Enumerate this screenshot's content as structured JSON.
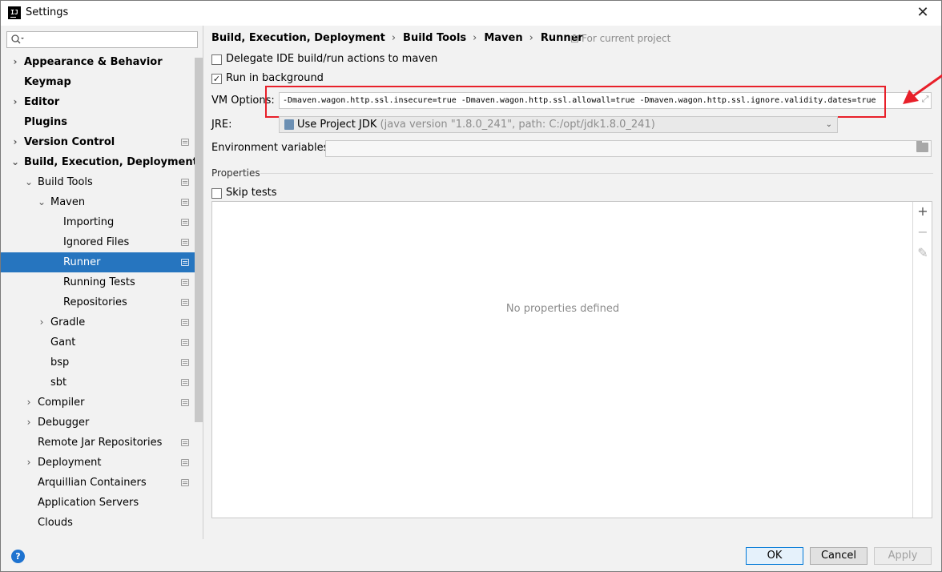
{
  "window": {
    "title": "Settings",
    "app_icon_text": "IJ",
    "close_glyph": "✕"
  },
  "sidebar": {
    "search_placeholder": "",
    "items": [
      {
        "label": "Appearance & Behavior",
        "bold": true,
        "expandable": true,
        "expanded": false,
        "level": 0,
        "config_icon": false,
        "selected": false
      },
      {
        "label": "Keymap",
        "bold": true,
        "expandable": false,
        "level": 0,
        "config_icon": false,
        "selected": false
      },
      {
        "label": "Editor",
        "bold": true,
        "expandable": true,
        "expanded": false,
        "level": 0,
        "config_icon": false,
        "selected": false
      },
      {
        "label": "Plugins",
        "bold": true,
        "expandable": false,
        "level": 0,
        "config_icon": false,
        "selected": false
      },
      {
        "label": "Version Control",
        "bold": true,
        "expandable": true,
        "expanded": false,
        "level": 0,
        "config_icon": true,
        "selected": false
      },
      {
        "label": "Build, Execution, Deployment",
        "bold": true,
        "expandable": true,
        "expanded": true,
        "level": 0,
        "config_icon": false,
        "selected": false
      },
      {
        "label": "Build Tools",
        "bold": false,
        "expandable": true,
        "expanded": true,
        "level": 1,
        "config_icon": true,
        "selected": false
      },
      {
        "label": "Maven",
        "bold": false,
        "expandable": true,
        "expanded": true,
        "level": 2,
        "config_icon": true,
        "selected": false
      },
      {
        "label": "Importing",
        "bold": false,
        "expandable": false,
        "level": 3,
        "config_icon": true,
        "selected": false
      },
      {
        "label": "Ignored Files",
        "bold": false,
        "expandable": false,
        "level": 3,
        "config_icon": true,
        "selected": false
      },
      {
        "label": "Runner",
        "bold": false,
        "expandable": false,
        "level": 3,
        "config_icon": true,
        "selected": true
      },
      {
        "label": "Running Tests",
        "bold": false,
        "expandable": false,
        "level": 3,
        "config_icon": true,
        "selected": false
      },
      {
        "label": "Repositories",
        "bold": false,
        "expandable": false,
        "level": 3,
        "config_icon": true,
        "selected": false
      },
      {
        "label": "Gradle",
        "bold": false,
        "expandable": true,
        "expanded": false,
        "level": 2,
        "config_icon": true,
        "selected": false
      },
      {
        "label": "Gant",
        "bold": false,
        "expandable": false,
        "level": 2,
        "config_icon": true,
        "selected": false
      },
      {
        "label": "bsp",
        "bold": false,
        "expandable": false,
        "level": 2,
        "config_icon": true,
        "selected": false
      },
      {
        "label": "sbt",
        "bold": false,
        "expandable": false,
        "level": 2,
        "config_icon": true,
        "selected": false
      },
      {
        "label": "Compiler",
        "bold": false,
        "expandable": true,
        "expanded": false,
        "level": 1,
        "config_icon": true,
        "selected": false
      },
      {
        "label": "Debugger",
        "bold": false,
        "expandable": true,
        "expanded": false,
        "level": 1,
        "config_icon": false,
        "selected": false
      },
      {
        "label": "Remote Jar Repositories",
        "bold": false,
        "expandable": false,
        "level": 1,
        "config_icon": true,
        "selected": false
      },
      {
        "label": "Deployment",
        "bold": false,
        "expandable": true,
        "expanded": false,
        "level": 1,
        "config_icon": true,
        "selected": false
      },
      {
        "label": "Arquillian Containers",
        "bold": false,
        "expandable": false,
        "level": 1,
        "config_icon": true,
        "selected": false
      },
      {
        "label": "Application Servers",
        "bold": false,
        "expandable": false,
        "level": 1,
        "config_icon": false,
        "selected": false
      },
      {
        "label": "Clouds",
        "bold": false,
        "expandable": false,
        "level": 1,
        "config_icon": false,
        "selected": false
      }
    ]
  },
  "breadcrumb": {
    "parts": [
      "Build, Execution, Deployment",
      "Build Tools",
      "Maven",
      "Runner"
    ],
    "separator": "›",
    "scope_label": "For current project"
  },
  "options": {
    "delegate": {
      "label": "Delegate IDE build/run actions to maven",
      "checked": false
    },
    "run_background": {
      "label": "Run in background",
      "checked": true
    },
    "vm_options": {
      "label": "VM Options:",
      "value": "-Dmaven.wagon.http.ssl.insecure=true -Dmaven.wagon.http.ssl.allowall=true -Dmaven.wagon.http.ssl.ignore.validity.dates=true"
    },
    "jre": {
      "label": "JRE:",
      "selected": "Use Project JDK",
      "detail": " (java version \"1.8.0_241\", path: C:/opt/jdk1.8.0_241)"
    },
    "env_vars": {
      "label": "Environment variables:",
      "value": ""
    }
  },
  "properties": {
    "section_title": "Properties",
    "skip_tests": {
      "label": "Skip tests",
      "checked": false
    },
    "empty_text": "No properties defined",
    "tools": {
      "add": "+",
      "remove": "−",
      "edit": "✎"
    }
  },
  "footer": {
    "help": "?",
    "ok": "OK",
    "cancel": "Cancel",
    "apply": "Apply"
  },
  "colors": {
    "selection": "#2675bf",
    "annotation_red": "#e8202a",
    "ok_border": "#0078d7"
  }
}
